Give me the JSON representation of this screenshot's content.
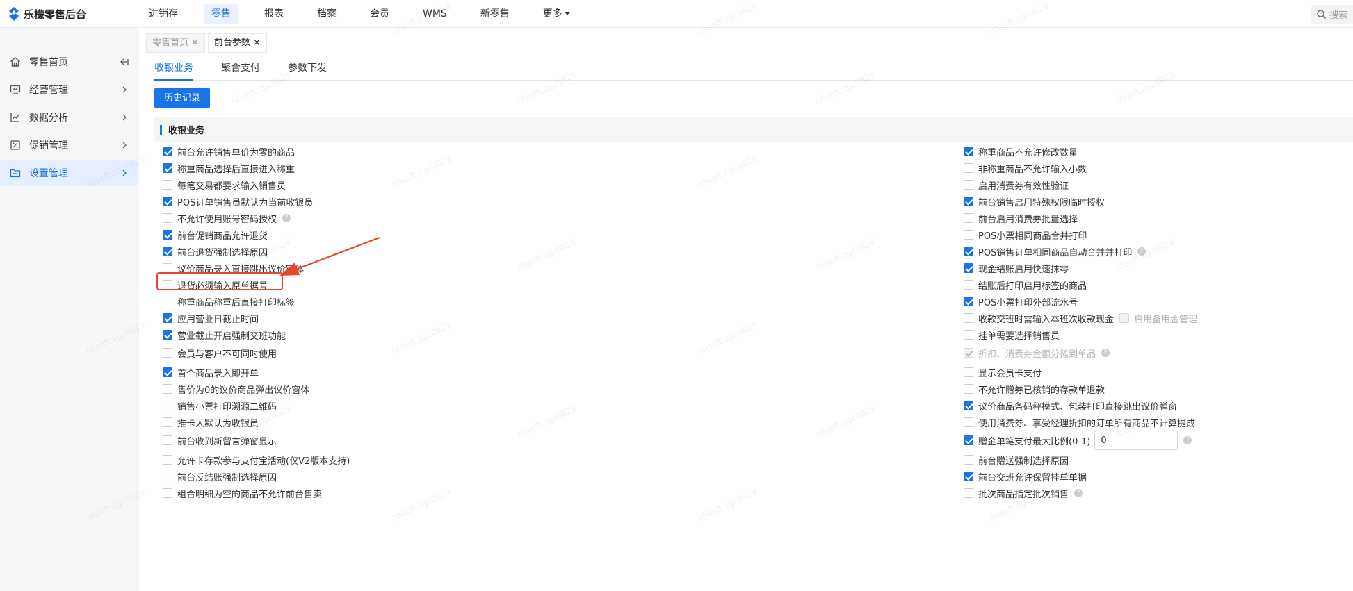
{
  "app": {
    "title": "乐檬零售后台"
  },
  "topnav": {
    "items": [
      "进销存",
      "零售",
      "报表",
      "档案",
      "会员",
      "WMS",
      "新零售",
      "更多"
    ],
    "active_index": 1,
    "search_placeholder": "搜索"
  },
  "sidebar": {
    "items": [
      {
        "label": "零售首页",
        "icon": "home-icon"
      },
      {
        "label": "经营管理",
        "icon": "monitor-icon"
      },
      {
        "label": "数据分析",
        "icon": "line-chart-icon"
      },
      {
        "label": "促销管理",
        "icon": "discount-icon"
      },
      {
        "label": "设置管理",
        "icon": "folder-icon"
      }
    ],
    "active_index": 4
  },
  "page_tabs": [
    {
      "label": "零售首页",
      "active": false
    },
    {
      "label": "前台参数",
      "active": true
    }
  ],
  "sub_tabs": {
    "items": [
      "收银业务",
      "聚合支付",
      "参数下发"
    ],
    "active_index": 0
  },
  "history_button": "历史记录",
  "section": {
    "title": "收银业务"
  },
  "left_options": [
    {
      "label": "前台允许销售单价为零的商品",
      "checked": true
    },
    {
      "label": "称重商品选择后直接进入称重",
      "checked": true
    },
    {
      "label": "每笔交易都要求输入销售员",
      "checked": false
    },
    {
      "label": "POS订单销售员默认为当前收银员",
      "checked": true
    },
    {
      "label": "不允许使用账号密码授权",
      "checked": false,
      "help": true
    },
    {
      "label": "前台促销商品允许退货",
      "checked": true
    },
    {
      "label": "前台退货强制选择原因",
      "checked": true
    },
    {
      "label": "议价商品录入直接跳出议价窗体",
      "checked": false
    },
    {
      "label": "退货必须输入原单据号",
      "checked": false
    },
    {
      "label": "称重商品称重后直接打印标签",
      "checked": false
    },
    {
      "label": "应用营业日截止时间",
      "checked": true
    },
    {
      "label": "营业截止开启强制交班功能",
      "checked": true
    },
    {
      "label": "会员与客户不可同时使用",
      "checked": false
    },
    {
      "label": "首个商品录入即开单",
      "checked": true
    },
    {
      "label": "售价为0的议价商品弹出议价窗体",
      "checked": false
    },
    {
      "label": "销售小票打印溯源二维码",
      "checked": false
    },
    {
      "label": "推卡人默认为收银员",
      "checked": false
    },
    {
      "label": "前台收到新留言弹窗显示",
      "checked": false
    },
    {
      "label": "允许卡存款参与支付宝活动(仅V2版本支持)",
      "checked": false
    },
    {
      "label": "前台反结账强制选择原因",
      "checked": false
    },
    {
      "label": "组合明细为空的商品不允许前台售卖",
      "checked": false
    }
  ],
  "right_options": [
    {
      "label": "称重商品不允许修改数量",
      "checked": true
    },
    {
      "label": "非称重商品不允许输入小数",
      "checked": false
    },
    {
      "label": "启用消费券有效性验证",
      "checked": false
    },
    {
      "label": "前台销售启用特殊权限临时授权",
      "checked": true
    },
    {
      "label": "前台启用消费券批量选择",
      "checked": false
    },
    {
      "label": "POS小票相同商品合并打印",
      "checked": false
    },
    {
      "label": "POS销售订单相同商品自动合并并打印",
      "checked": true,
      "help": true
    },
    {
      "label": "现金结账启用快速抹零",
      "checked": true
    },
    {
      "label": "结账后打印启用标签的商品",
      "checked": false
    },
    {
      "label": "POS小票打印外部流水号",
      "checked": true
    },
    {
      "label": "收款交班时需输入本班次收款现金",
      "checked": false,
      "sub": "启用备用金管理"
    },
    {
      "label": "挂单需要选择销售员",
      "checked": false
    },
    {
      "label": "折扣、消费券金额分摊到单品",
      "checked": true,
      "disabled": true,
      "help": true
    },
    {
      "label": "显示会员卡支付",
      "checked": false
    },
    {
      "label": "不允许赠券已核销的存款单退款",
      "checked": false
    },
    {
      "label": "议价商品条码秤模式、包装打印直接跳出议价弹窗",
      "checked": true
    },
    {
      "label": "使用消费券、享受经理折扣的订单所有商品不计算提成",
      "checked": false
    },
    {
      "label": "赠金单笔支付最大比例(0-1)",
      "checked": true,
      "input": "0",
      "help": true
    },
    {
      "label": "前台赠送强制选择原因",
      "checked": false
    },
    {
      "label": "前台交班允许保留挂单单据",
      "checked": true
    },
    {
      "label": "批次商品指定批次销售",
      "checked": false,
      "help": true
    }
  ],
  "watermark": "nhsoft.zgc0829",
  "colors": {
    "accent": "#1a73e8",
    "annotation": "#e8452c"
  }
}
